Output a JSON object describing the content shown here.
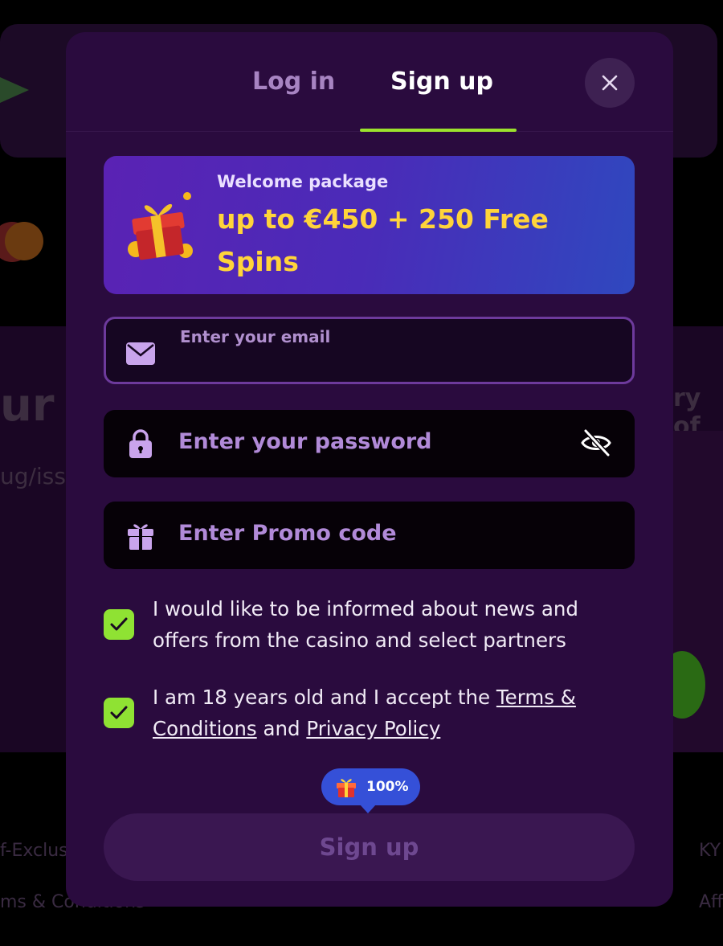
{
  "background": {
    "hero_title_fragment": "ur e",
    "hero_subtitle_fragment": "ug/iss",
    "side_text_fragment": "ry of",
    "footer_1": "f-Exclus",
    "footer_2": "ms & Conditions",
    "footer_3": "KY",
    "footer_4": "Aff"
  },
  "tabs": {
    "login_label": "Log in",
    "signup_label": "Sign up",
    "active": "signup"
  },
  "close_icon": "close-icon",
  "promo": {
    "label": "Welcome package",
    "offer": "up to €450 + 250 Free Spins",
    "icon": "gift-box-icon"
  },
  "form": {
    "email": {
      "label": "Enter your email",
      "value": "",
      "icon": "mail-icon"
    },
    "password": {
      "placeholder": "Enter your password",
      "icon": "lock-icon",
      "toggle_icon": "eye-slash-icon"
    },
    "promo_code": {
      "placeholder": "Enter Promo code",
      "icon": "gift-icon"
    }
  },
  "consents": {
    "news": {
      "checked": true,
      "text": "I would like to be informed about news and offers from the casino and select partners"
    },
    "terms": {
      "checked": true,
      "text_prefix": "I am 18 years old and I accept the ",
      "terms_link": "Terms & Conditions",
      "text_middle": " and ",
      "privacy_link": "Privacy Policy"
    }
  },
  "bonus_badge": {
    "value": "100%",
    "icon": "gift-icon"
  },
  "submit_label": "Sign up",
  "colors": {
    "modal_bg": "#2a0b3e",
    "accent_green": "#9be22d",
    "promo_yellow": "#ffd43a",
    "badge_blue": "#3550d8"
  }
}
